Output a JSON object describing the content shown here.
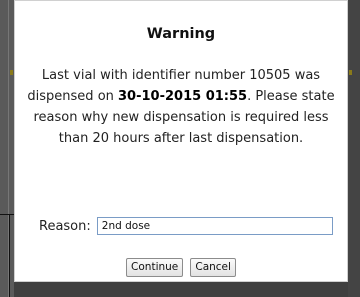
{
  "dialog": {
    "title": "Warning",
    "message": {
      "part1": "Last vial with identifier number 10505 was dispensed on ",
      "timestamp": "30-10-2015 01:55",
      "part2": ". Please state reason why new dispensation is required less than 20 hours after last dispensation."
    },
    "reason": {
      "label": "Reason:",
      "value": "2nd dose"
    },
    "buttons": {
      "continue_label": "Continue",
      "cancel_label": "Cancel"
    }
  }
}
